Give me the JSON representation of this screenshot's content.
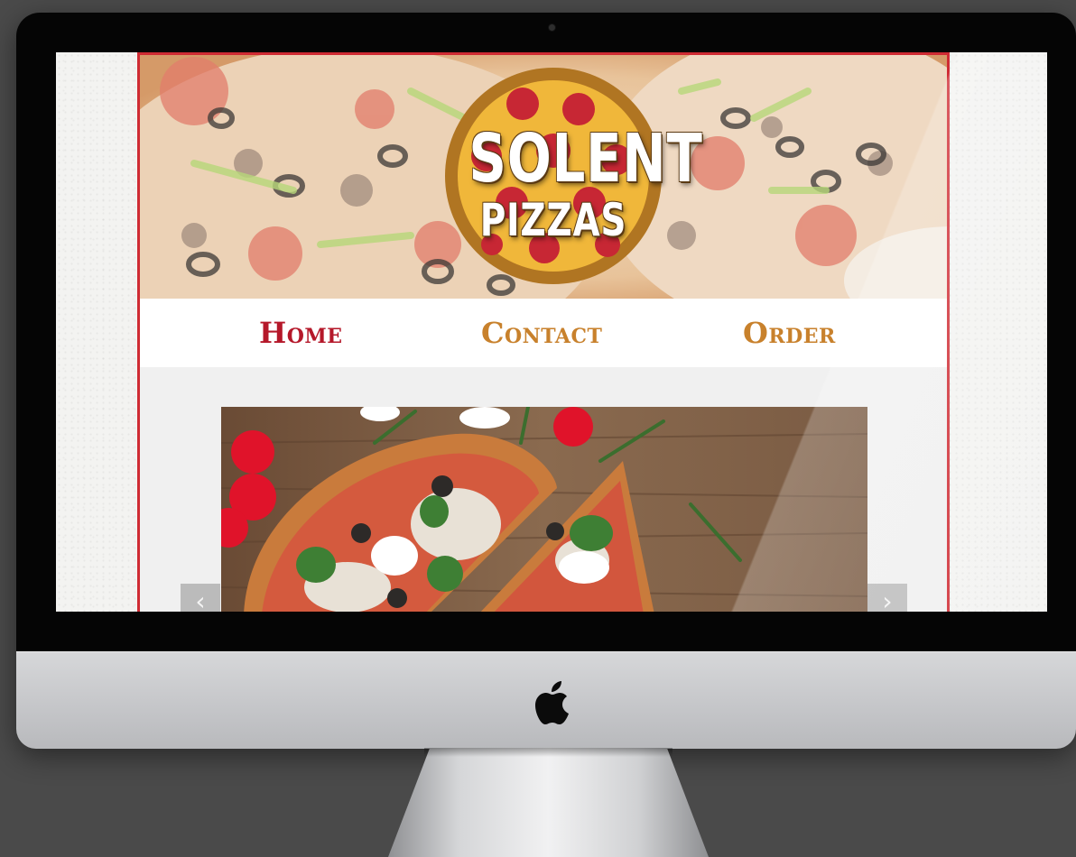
{
  "site": {
    "logo": {
      "line1": "SOLENT",
      "line2": "PIZZAS"
    },
    "nav": [
      {
        "label": "Home",
        "color": "#b5182a"
      },
      {
        "label": "Contact",
        "color": "#c8812c"
      },
      {
        "label": "Order",
        "color": "#c8812c"
      }
    ],
    "carousel": {
      "prev_icon": "‹",
      "next_icon": "›"
    }
  },
  "colors": {
    "accent_red": "#cf2b33",
    "nav_active": "#b5182a",
    "nav_inactive": "#c8812c"
  },
  "icons": [
    "apple-logo-icon",
    "chevron-left-icon",
    "chevron-right-icon"
  ]
}
